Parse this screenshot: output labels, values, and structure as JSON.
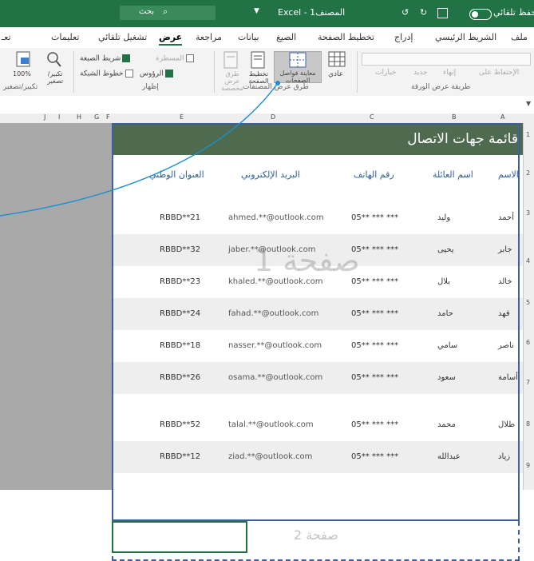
{
  "titlebar": {
    "autosave_label": "حفظ تلقائي",
    "app_title": "Excel - المصنف1",
    "search_label": "بحث"
  },
  "ribbon_tabs": [
    "ملف",
    "الشريط الرئيسي",
    "إدراج",
    "تخطيط الصفحة",
    "الصيغ",
    "بيانات",
    "مراجعة",
    "عرض",
    "تشغيل تلقائي",
    "تعليمات",
    "تعـ"
  ],
  "active_tab": "عرض",
  "ribbon": {
    "views_group": {
      "label": "طرق عرض المصنفات",
      "normal": "عادي",
      "page_break_preview": "معاينة فواصل الصفحات",
      "page_layout": "تخطيط الصفحة",
      "custom_views": "طرق عرض مخصصة"
    },
    "sheet_view_group": {
      "label": "طريقة عرض الورقة",
      "options": [
        "الإحتفاظ على",
        "إنهاء",
        "جديد",
        "خيارات"
      ]
    },
    "show_group": {
      "label": "إظهار",
      "formula_bar": "شريط الصيغة",
      "gridlines": "خطوط الشبكة",
      "headings": "الرؤوس",
      "ruler": "المسطرة"
    },
    "zoom_group": {
      "label": "تكبير/تصغير",
      "zoom": "تكبير/تصغير",
      "hundred": "100%"
    }
  },
  "columns": [
    "A",
    "B",
    "C",
    "D",
    "E",
    "F",
    "G",
    "H",
    "I",
    "J"
  ],
  "sheet": {
    "title": "قائمة جهات الاتصال",
    "headers": {
      "first_name": "الاسم",
      "last_name": "اسم العائلة",
      "phone": "رقم الهاتف",
      "email": "البريد الإلكتروني",
      "national_address": "العنوان الوطني"
    },
    "rows": [
      {
        "first": "أحمد",
        "last": "وليد",
        "phone": "05** *** ***",
        "email": "ahmed.**@outlook.com",
        "addr": "RBBD**21"
      },
      {
        "first": "جابر",
        "last": "يحيى",
        "phone": "05** *** ***",
        "email": "jaber.**@outlook.com",
        "addr": "RBBD**32"
      },
      {
        "first": "خالد",
        "last": "بلال",
        "phone": "05** *** ***",
        "email": "khaled.**@outlook.com",
        "addr": "RBBD**23"
      },
      {
        "first": "فهد",
        "last": "حامد",
        "phone": "05** *** ***",
        "email": "fahad.**@outlook.com",
        "addr": "RBBD**24"
      },
      {
        "first": "ناصر",
        "last": "سامي",
        "phone": "05** *** ***",
        "email": "nasser.**@outlook.com",
        "addr": "RBBD**18"
      },
      {
        "first": "أسامة",
        "last": "سعود",
        "phone": "05** *** ***",
        "email": "osama.**@outlook.com",
        "addr": "RBBD**26"
      },
      {
        "first": "طلال",
        "last": "محمد",
        "phone": "05** *** ***",
        "email": "talal.**@outlook.com",
        "addr": "RBBD**52"
      },
      {
        "first": "زياد",
        "last": "عبدالله",
        "phone": "05** *** ***",
        "email": "ziad.**@outlook.com",
        "addr": "RBBD**12"
      }
    ],
    "page1_label": "صفحة 1",
    "page2_label": "صفحة 2"
  },
  "row_numbers": [
    "1",
    "2",
    "3",
    "4",
    "5",
    "6",
    "7",
    "8",
    "9"
  ],
  "colors": {
    "excel_green": "#217346",
    "banner": "#4f6b4f",
    "page_border": "#3b5fa0",
    "callout": "#1a8fd0"
  }
}
